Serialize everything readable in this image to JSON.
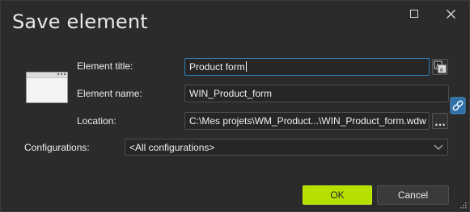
{
  "window": {
    "title": "Save element",
    "maximize_icon": "maximize-icon",
    "close_icon": "close-icon"
  },
  "form": {
    "element_title": {
      "label": "Element title:",
      "value": "Product form",
      "translate_icon": "translate-icon"
    },
    "element_name": {
      "label": "Element name:",
      "value": "WIN_Product_form"
    },
    "location": {
      "label": "Location:",
      "value": "C:\\Mes projets\\WM_Product...\\WIN_Product_form.wdw",
      "browse_label": "..."
    },
    "link_icon": "link-icon",
    "configurations": {
      "label": "Configurations:",
      "selected": "<All configurations>"
    }
  },
  "buttons": {
    "ok_label": "OK",
    "cancel_label": "Cancel"
  },
  "colors": {
    "background": "#2b2b2b",
    "accent_ok": "#b6e000",
    "focus_border": "#2f7fb7",
    "link_icon": "#3a8fd6"
  }
}
